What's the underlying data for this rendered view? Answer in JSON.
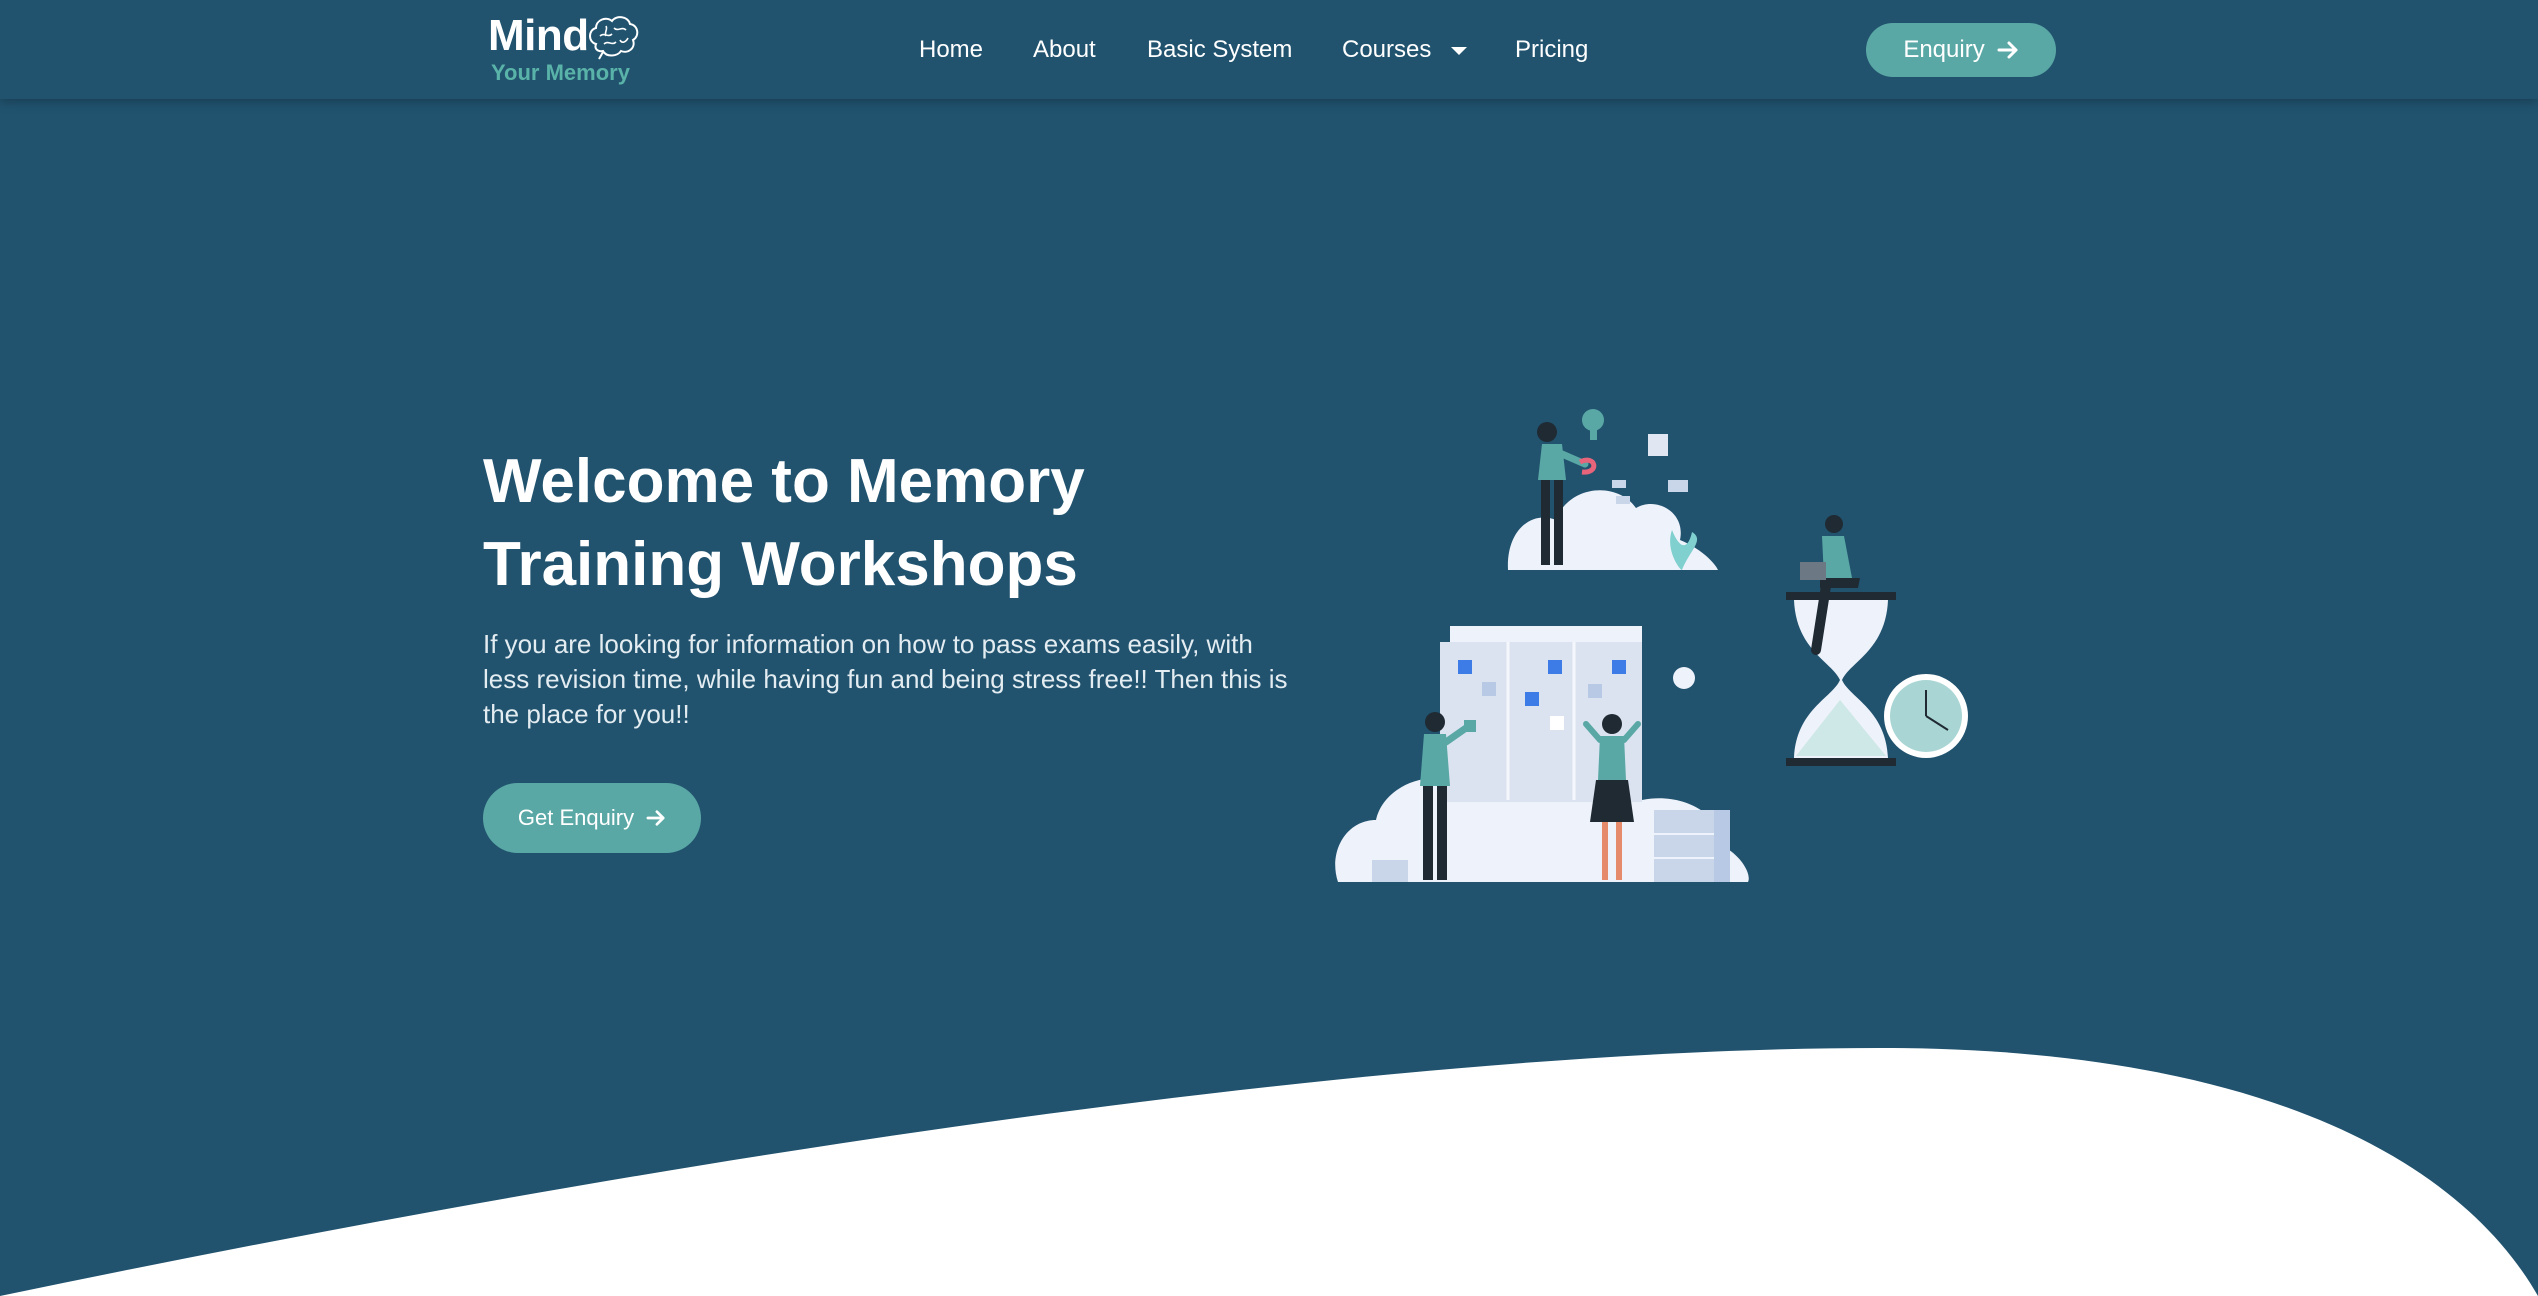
{
  "header": {
    "logo": {
      "title": "Mind",
      "subtitle": "Your Memory",
      "icon": "brain-icon"
    },
    "nav": [
      {
        "label": "Home"
      },
      {
        "label": "About"
      },
      {
        "label": "Basic System"
      },
      {
        "label": "Courses",
        "icon": "caret-down-icon"
      },
      {
        "label": "Pricing"
      }
    ],
    "cta": {
      "label": "Enquiry",
      "icon": "arrow-right-icon"
    }
  },
  "hero": {
    "title_line1": "Welcome to Memory",
    "title_line2": "Training Workshops",
    "text": "If you are looking for information on how to pass exams easily, with less revision time, while having fun and being stress free!! Then this is the place for you!!",
    "button": {
      "label": "Get Enquiry",
      "icon": "arrow-right-icon"
    }
  },
  "colors": {
    "background": "#21536f",
    "accent": "#5aa8a5",
    "logo_subtitle": "#5ab3a8",
    "wave": "#ffffff"
  }
}
